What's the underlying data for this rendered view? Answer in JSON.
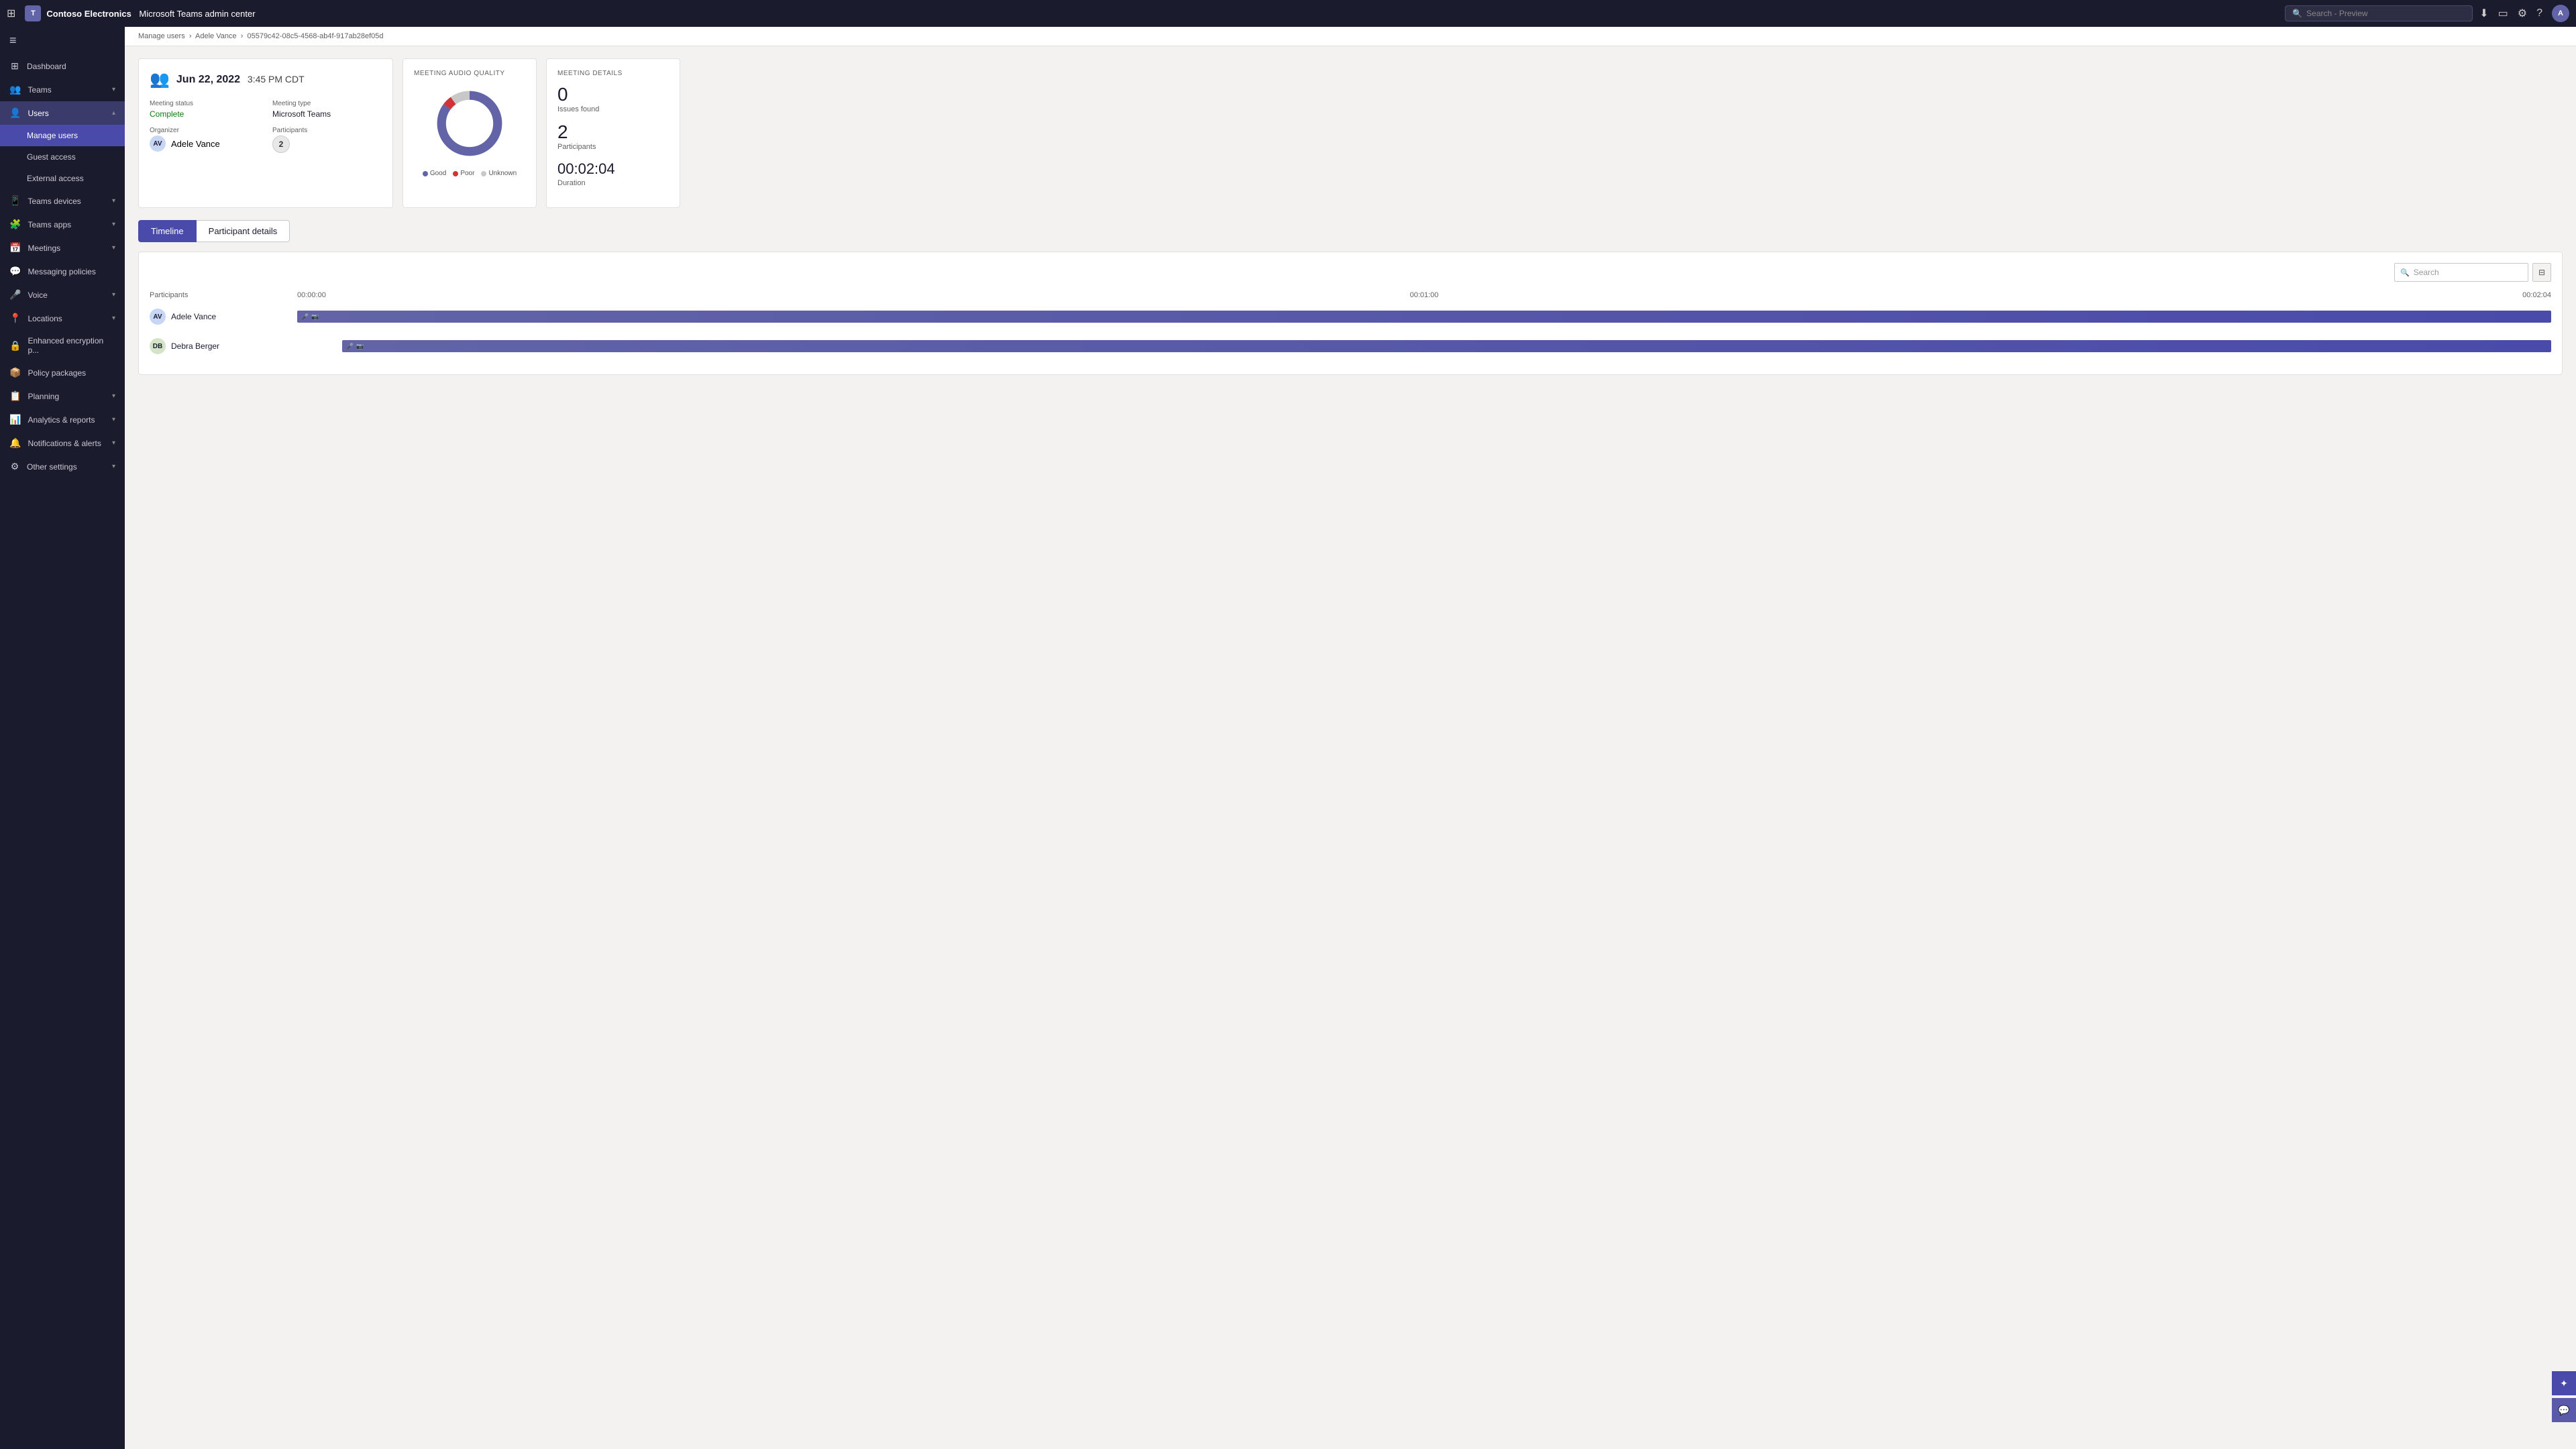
{
  "topbar": {
    "waffle_icon": "⊞",
    "brand_logo": "T",
    "brand_name": "Contoso Electronics",
    "app_title": "Microsoft Teams admin center",
    "search_placeholder": "Search - Preview",
    "download_icon": "⬇",
    "window_icon": "▭",
    "settings_icon": "⚙",
    "help_icon": "?",
    "user_initials": "A"
  },
  "sidebar": {
    "hamburger_icon": "≡",
    "items": [
      {
        "id": "dashboard",
        "icon": "⊞",
        "label": "Dashboard",
        "expandable": false,
        "active": false
      },
      {
        "id": "teams",
        "icon": "👥",
        "label": "Teams",
        "expandable": true,
        "active": false
      },
      {
        "id": "users",
        "icon": "👤",
        "label": "Users",
        "expandable": true,
        "active": true
      },
      {
        "id": "manage-users",
        "icon": "",
        "label": "Manage users",
        "expandable": false,
        "active": true,
        "sub": true
      },
      {
        "id": "guest-access",
        "icon": "",
        "label": "Guest access",
        "expandable": false,
        "active": false,
        "sub": true
      },
      {
        "id": "external-access",
        "icon": "",
        "label": "External access",
        "expandable": false,
        "active": false,
        "sub": true
      },
      {
        "id": "teams-devices",
        "icon": "📱",
        "label": "Teams devices",
        "expandable": true,
        "active": false
      },
      {
        "id": "teams-apps",
        "icon": "🧩",
        "label": "Teams apps",
        "expandable": true,
        "active": false
      },
      {
        "id": "meetings",
        "icon": "📅",
        "label": "Meetings",
        "expandable": true,
        "active": false
      },
      {
        "id": "messaging",
        "icon": "💬",
        "label": "Messaging policies",
        "expandable": false,
        "active": false
      },
      {
        "id": "voice",
        "icon": "🎤",
        "label": "Voice",
        "expandable": true,
        "active": false
      },
      {
        "id": "locations",
        "icon": "📍",
        "label": "Locations",
        "expandable": true,
        "active": false
      },
      {
        "id": "encryption",
        "icon": "🔒",
        "label": "Enhanced encryption p...",
        "expandable": false,
        "active": false
      },
      {
        "id": "policy-packages",
        "icon": "📦",
        "label": "Policy packages",
        "expandable": false,
        "active": false
      },
      {
        "id": "planning",
        "icon": "📋",
        "label": "Planning",
        "expandable": true,
        "active": false
      },
      {
        "id": "analytics",
        "icon": "📊",
        "label": "Analytics & reports",
        "expandable": true,
        "active": false
      },
      {
        "id": "notifications",
        "icon": "🔔",
        "label": "Notifications & alerts",
        "expandable": true,
        "active": false
      },
      {
        "id": "other",
        "icon": "⚙",
        "label": "Other settings",
        "expandable": true,
        "active": false
      }
    ]
  },
  "breadcrumb": {
    "parts": [
      "Manage users",
      "Adele Vance",
      "05579c42-08c5-4568-ab4f-917ab28ef05d"
    ]
  },
  "meeting_info": {
    "icon": "👥",
    "date": "Jun 22, 2022",
    "time": "3:45 PM CDT",
    "status_label": "Meeting status",
    "status_value": "Complete",
    "type_label": "Meeting type",
    "type_value": "Microsoft Teams",
    "organizer_label": "Organizer",
    "organizer_name": "Adele Vance",
    "organizer_initials": "AV",
    "participants_label": "Participants",
    "participants_count": "2"
  },
  "audio_quality": {
    "title": "MEETING AUDIO QUALITY",
    "donut": {
      "good_pct": 85,
      "poor_pct": 5,
      "unknown_pct": 10,
      "good_color": "#6264a7",
      "poor_color": "#d13438",
      "unknown_color": "#c8c8c8"
    },
    "legend": [
      {
        "label": "Good",
        "color": "#6264a7"
      },
      {
        "label": "Poor",
        "color": "#d13438"
      },
      {
        "label": "Unknown",
        "color": "#c8c8c8"
      }
    ]
  },
  "meeting_details": {
    "title": "MEETING DETAILS",
    "issues_found_number": "0",
    "issues_found_label": "Issues found",
    "participants_number": "2",
    "participants_label": "Participants",
    "duration_value": "00:02:04",
    "duration_label": "Duration"
  },
  "tabs": {
    "items": [
      {
        "id": "timeline",
        "label": "Timeline",
        "active": true
      },
      {
        "id": "participant-details",
        "label": "Participant details",
        "active": false
      }
    ]
  },
  "timeline": {
    "search_placeholder": "Search",
    "filter_icon": "⊟",
    "column_participants": "Participants",
    "time_start": "00:00:00",
    "time_mid": "00:01:00",
    "time_end": "00:02:04",
    "participants": [
      {
        "id": "adele-vance",
        "name": "Adele Vance",
        "initials": "AV"
      },
      {
        "id": "debra-berger",
        "name": "Debra Berger",
        "initials": "DB"
      }
    ]
  }
}
